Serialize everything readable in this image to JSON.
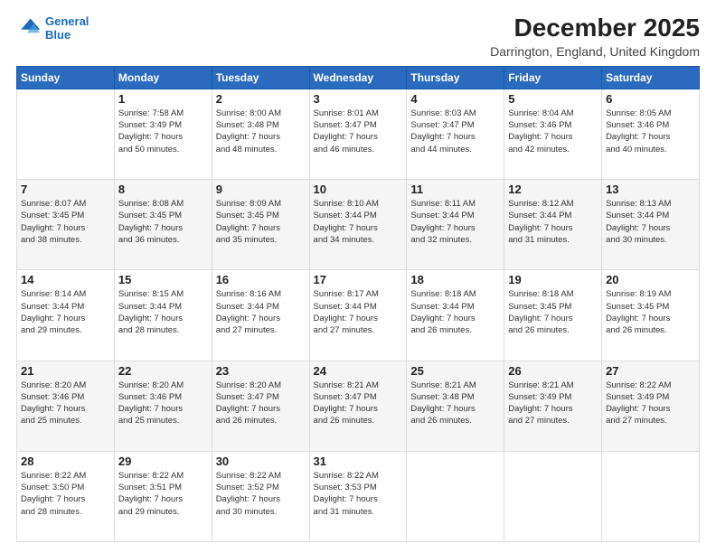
{
  "logo": {
    "line1": "General",
    "line2": "Blue"
  },
  "title": "December 2025",
  "subtitle": "Darrington, England, United Kingdom",
  "days_header": [
    "Sunday",
    "Monday",
    "Tuesday",
    "Wednesday",
    "Thursday",
    "Friday",
    "Saturday"
  ],
  "weeks": [
    [
      {
        "num": "",
        "detail": ""
      },
      {
        "num": "1",
        "detail": "Sunrise: 7:58 AM\nSunset: 3:49 PM\nDaylight: 7 hours\nand 50 minutes."
      },
      {
        "num": "2",
        "detail": "Sunrise: 8:00 AM\nSunset: 3:48 PM\nDaylight: 7 hours\nand 48 minutes."
      },
      {
        "num": "3",
        "detail": "Sunrise: 8:01 AM\nSunset: 3:47 PM\nDaylight: 7 hours\nand 46 minutes."
      },
      {
        "num": "4",
        "detail": "Sunrise: 8:03 AM\nSunset: 3:47 PM\nDaylight: 7 hours\nand 44 minutes."
      },
      {
        "num": "5",
        "detail": "Sunrise: 8:04 AM\nSunset: 3:46 PM\nDaylight: 7 hours\nand 42 minutes."
      },
      {
        "num": "6",
        "detail": "Sunrise: 8:05 AM\nSunset: 3:46 PM\nDaylight: 7 hours\nand 40 minutes."
      }
    ],
    [
      {
        "num": "7",
        "detail": "Sunrise: 8:07 AM\nSunset: 3:45 PM\nDaylight: 7 hours\nand 38 minutes."
      },
      {
        "num": "8",
        "detail": "Sunrise: 8:08 AM\nSunset: 3:45 PM\nDaylight: 7 hours\nand 36 minutes."
      },
      {
        "num": "9",
        "detail": "Sunrise: 8:09 AM\nSunset: 3:45 PM\nDaylight: 7 hours\nand 35 minutes."
      },
      {
        "num": "10",
        "detail": "Sunrise: 8:10 AM\nSunset: 3:44 PM\nDaylight: 7 hours\nand 34 minutes."
      },
      {
        "num": "11",
        "detail": "Sunrise: 8:11 AM\nSunset: 3:44 PM\nDaylight: 7 hours\nand 32 minutes."
      },
      {
        "num": "12",
        "detail": "Sunrise: 8:12 AM\nSunset: 3:44 PM\nDaylight: 7 hours\nand 31 minutes."
      },
      {
        "num": "13",
        "detail": "Sunrise: 8:13 AM\nSunset: 3:44 PM\nDaylight: 7 hours\nand 30 minutes."
      }
    ],
    [
      {
        "num": "14",
        "detail": "Sunrise: 8:14 AM\nSunset: 3:44 PM\nDaylight: 7 hours\nand 29 minutes."
      },
      {
        "num": "15",
        "detail": "Sunrise: 8:15 AM\nSunset: 3:44 PM\nDaylight: 7 hours\nand 28 minutes."
      },
      {
        "num": "16",
        "detail": "Sunrise: 8:16 AM\nSunset: 3:44 PM\nDaylight: 7 hours\nand 27 minutes."
      },
      {
        "num": "17",
        "detail": "Sunrise: 8:17 AM\nSunset: 3:44 PM\nDaylight: 7 hours\nand 27 minutes."
      },
      {
        "num": "18",
        "detail": "Sunrise: 8:18 AM\nSunset: 3:44 PM\nDaylight: 7 hours\nand 26 minutes."
      },
      {
        "num": "19",
        "detail": "Sunrise: 8:18 AM\nSunset: 3:45 PM\nDaylight: 7 hours\nand 26 minutes."
      },
      {
        "num": "20",
        "detail": "Sunrise: 8:19 AM\nSunset: 3:45 PM\nDaylight: 7 hours\nand 26 minutes."
      }
    ],
    [
      {
        "num": "21",
        "detail": "Sunrise: 8:20 AM\nSunset: 3:46 PM\nDaylight: 7 hours\nand 25 minutes."
      },
      {
        "num": "22",
        "detail": "Sunrise: 8:20 AM\nSunset: 3:46 PM\nDaylight: 7 hours\nand 25 minutes."
      },
      {
        "num": "23",
        "detail": "Sunrise: 8:20 AM\nSunset: 3:47 PM\nDaylight: 7 hours\nand 26 minutes."
      },
      {
        "num": "24",
        "detail": "Sunrise: 8:21 AM\nSunset: 3:47 PM\nDaylight: 7 hours\nand 26 minutes."
      },
      {
        "num": "25",
        "detail": "Sunrise: 8:21 AM\nSunset: 3:48 PM\nDaylight: 7 hours\nand 26 minutes."
      },
      {
        "num": "26",
        "detail": "Sunrise: 8:21 AM\nSunset: 3:49 PM\nDaylight: 7 hours\nand 27 minutes."
      },
      {
        "num": "27",
        "detail": "Sunrise: 8:22 AM\nSunset: 3:49 PM\nDaylight: 7 hours\nand 27 minutes."
      }
    ],
    [
      {
        "num": "28",
        "detail": "Sunrise: 8:22 AM\nSunset: 3:50 PM\nDaylight: 7 hours\nand 28 minutes."
      },
      {
        "num": "29",
        "detail": "Sunrise: 8:22 AM\nSunset: 3:51 PM\nDaylight: 7 hours\nand 29 minutes."
      },
      {
        "num": "30",
        "detail": "Sunrise: 8:22 AM\nSunset: 3:52 PM\nDaylight: 7 hours\nand 30 minutes."
      },
      {
        "num": "31",
        "detail": "Sunrise: 8:22 AM\nSunset: 3:53 PM\nDaylight: 7 hours\nand 31 minutes."
      },
      {
        "num": "",
        "detail": ""
      },
      {
        "num": "",
        "detail": ""
      },
      {
        "num": "",
        "detail": ""
      }
    ]
  ]
}
